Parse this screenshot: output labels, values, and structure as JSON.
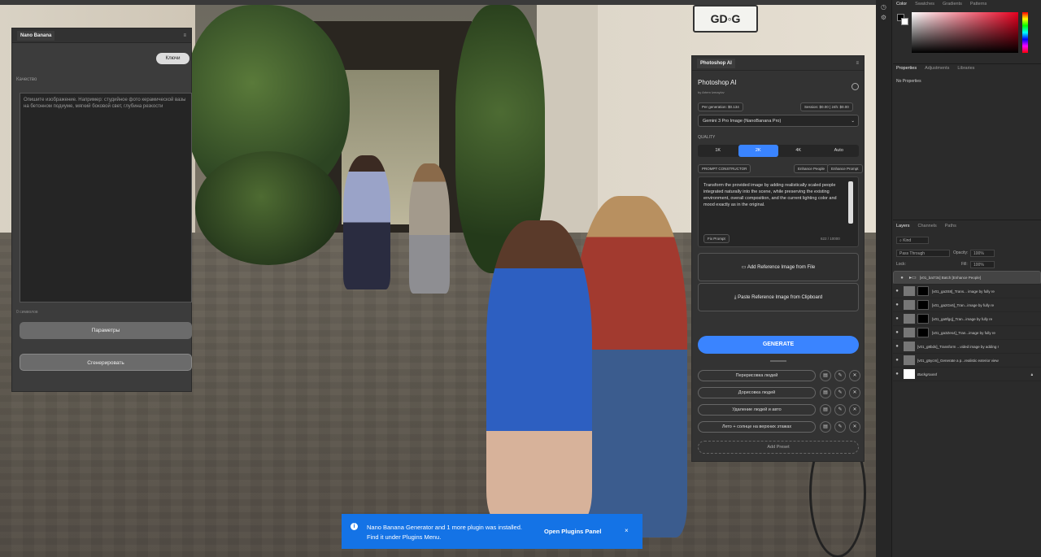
{
  "nano_panel": {
    "title": "Nano Banana",
    "keys_button": "Ключи",
    "quality_label": "Качество",
    "prompt_placeholder": "Опишите изображение. Например: студийное фото керамической вазы на бетонном подиуме, мягкий боковой свет, глубина резкости",
    "char_count": "0 символов",
    "params_button": "Параметры",
    "generate_button": "Сгенерировать"
  },
  "psai_panel": {
    "tab_title": "Photoshop AI",
    "title": "Photoshop AI",
    "author": "by Artem Izmaylov",
    "per_generation": "Per generation: $0.134",
    "session": "Session: $0.00 | 24h: $0.00",
    "model_select": "Gemini 3 Pro Image (NanoBanana Pro)",
    "quality_label": "QUALITY",
    "quality_options": [
      "1K",
      "2K",
      "4K",
      "Auto"
    ],
    "quality_selected": "2K",
    "prompt_constructor": "PROMPT CONSTRUCTOR",
    "enhance_people": "Enhance People",
    "enhance_prompt": "Enhance Prompt",
    "prompt_text": "Transform the provided image by adding realistically scaled people integrated naturally into the scene, while preserving the existing environment, overall composition, and the current lighting color and mood exactly as in the original.",
    "fix_prompt": "Fix Prompt",
    "prompt_count": "622 / 10000",
    "add_reference_file": "Add Reference Image from File",
    "paste_reference": "Paste Reference Image from Clipboard",
    "generate": "GENERATE",
    "presets": [
      "Перерисовка людей",
      "Дорисовка людей",
      "Удаление людей и авто",
      "Лето + солнце на верхних этажах"
    ],
    "add_preset": "Add Preset"
  },
  "right_dock": {
    "color_tabs": [
      "Color",
      "Swatches",
      "Gradients",
      "Patterns"
    ],
    "props_tabs": [
      "Properties",
      "Adjustments",
      "Libraries"
    ],
    "no_properties": "No Properties",
    "layers_tabs": [
      "Layers",
      "Channels",
      "Paths"
    ],
    "kind": "Kind",
    "blend_mode": "Pass Through",
    "opacity_label": "Opacity:",
    "opacity": "100%",
    "lock_label": "Lock:",
    "fill_label": "Fill:",
    "fill": "100%",
    "layers": [
      {
        "name": "[v01_bat73s] Batch [Enhance People]",
        "type": "group"
      },
      {
        "name": "[v01_ga3S8]_Trans... image by fully re",
        "type": "masked"
      },
      {
        "name": "[v01_ga2Gv6]_Tran...image by fully re",
        "type": "masked"
      },
      {
        "name": "[v01_ga9fgq]_Tran...image by fully re",
        "type": "masked"
      },
      {
        "name": "[v01_ga3Zes4]_Tran...image by fully re",
        "type": "masked"
      },
      {
        "name": "[v01_g8bds]_Transform ...vided image by adding r",
        "type": "plain"
      },
      {
        "name": "[v01_g5ycm]_Generate a p...realistic exterior view",
        "type": "plain"
      },
      {
        "name": "Background",
        "type": "background"
      }
    ]
  },
  "toast": {
    "message": "Nano Banana Generator and 1 more plugin was installed. Find it under Plugins Menu.",
    "action": "Open Plugins Panel",
    "close": "×"
  },
  "photo_sign": "GD◦G",
  "colors": {
    "accent": "#3a84ff",
    "toast": "#1473e6",
    "panel": "#3c3c3c"
  }
}
